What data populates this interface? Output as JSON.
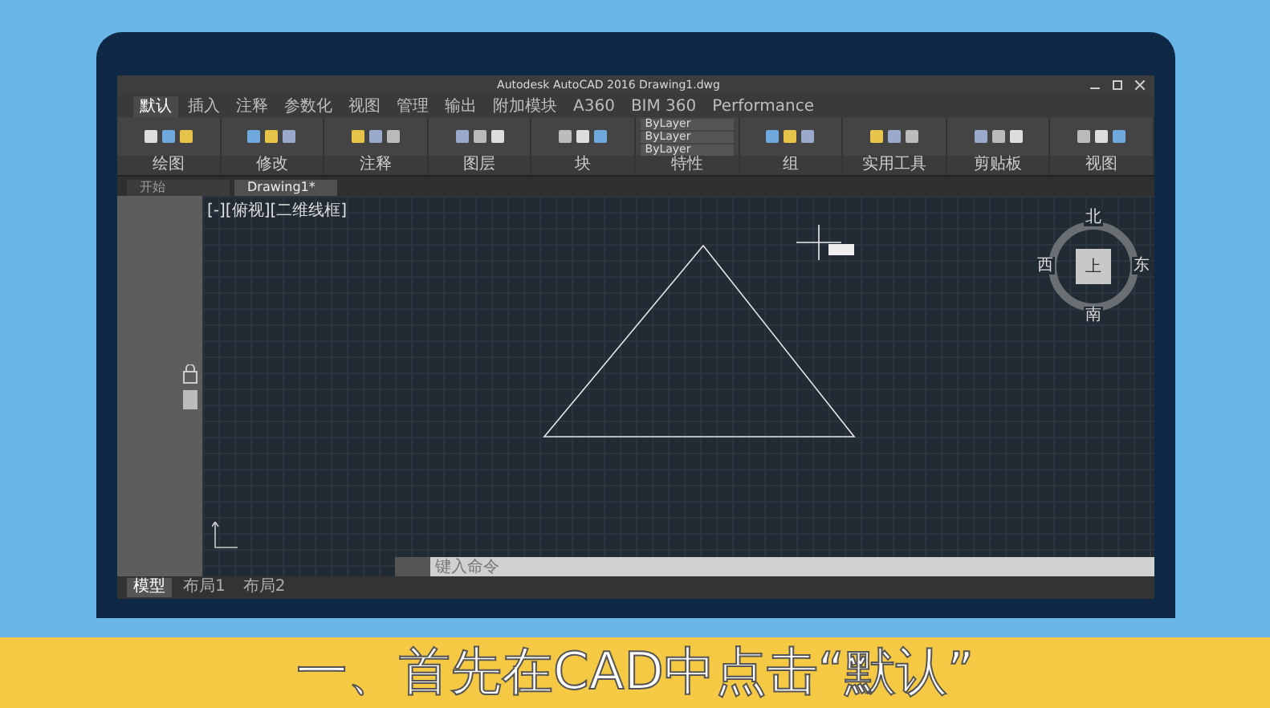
{
  "window": {
    "title": "Autodesk AutoCAD 2016    Drawing1.dwg"
  },
  "ribbon_tabs": [
    {
      "label": "默认",
      "selected": true
    },
    {
      "label": "插入",
      "selected": false
    },
    {
      "label": "注释",
      "selected": false
    },
    {
      "label": "参数化",
      "selected": false
    },
    {
      "label": "视图",
      "selected": false
    },
    {
      "label": "管理",
      "selected": false
    },
    {
      "label": "输出",
      "selected": false
    },
    {
      "label": "附加模块",
      "selected": false
    },
    {
      "label": "A360",
      "selected": false
    },
    {
      "label": "BIM 360",
      "selected": false
    },
    {
      "label": "Performance",
      "selected": false
    }
  ],
  "ribbon_panels": [
    {
      "label": "绘图"
    },
    {
      "label": "修改"
    },
    {
      "label": "注释"
    },
    {
      "label": "图层"
    },
    {
      "label": "块"
    },
    {
      "label": "特性",
      "fields": [
        "ByLayer",
        "ByLayer",
        "ByLayer"
      ]
    },
    {
      "label": "组"
    },
    {
      "label": "实用工具"
    },
    {
      "label": "剪贴板"
    },
    {
      "label": "视图"
    }
  ],
  "file_tabs": [
    {
      "label": "开始",
      "selected": false
    },
    {
      "label": "Drawing1*",
      "selected": true
    }
  ],
  "viewport": {
    "label": "[-][俯视][二维线框]"
  },
  "viewcube": {
    "north": "北",
    "east": "东",
    "south": "南",
    "west": "西",
    "face": "上"
  },
  "command_line": {
    "placeholder": "键入命令"
  },
  "layout_tabs": [
    {
      "label": "模型",
      "selected": true
    },
    {
      "label": "布局1",
      "selected": false
    },
    {
      "label": "布局2",
      "selected": false
    }
  ],
  "subtitle": "一、首先在CAD中点击“默认”"
}
